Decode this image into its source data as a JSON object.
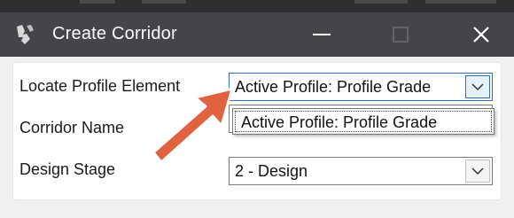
{
  "window": {
    "title": "Create Corridor",
    "minimize_icon": "minimize-icon",
    "maximize_icon": "maximize-icon",
    "close_icon": "close-icon"
  },
  "form": {
    "fields": [
      {
        "label": "Locate Profile Element",
        "value": "Active Profile: Profile Grade"
      },
      {
        "label": "Corridor Name",
        "value": ""
      },
      {
        "label": "Design Stage",
        "value": "2 - Design"
      }
    ],
    "dropdown_open": {
      "items": [
        "Active Profile: Profile Grade"
      ]
    }
  },
  "annotation": {
    "arrow_color": "#e0623e"
  },
  "colors": {
    "titlebar": "#454549",
    "accent": "#2f6fc0"
  }
}
